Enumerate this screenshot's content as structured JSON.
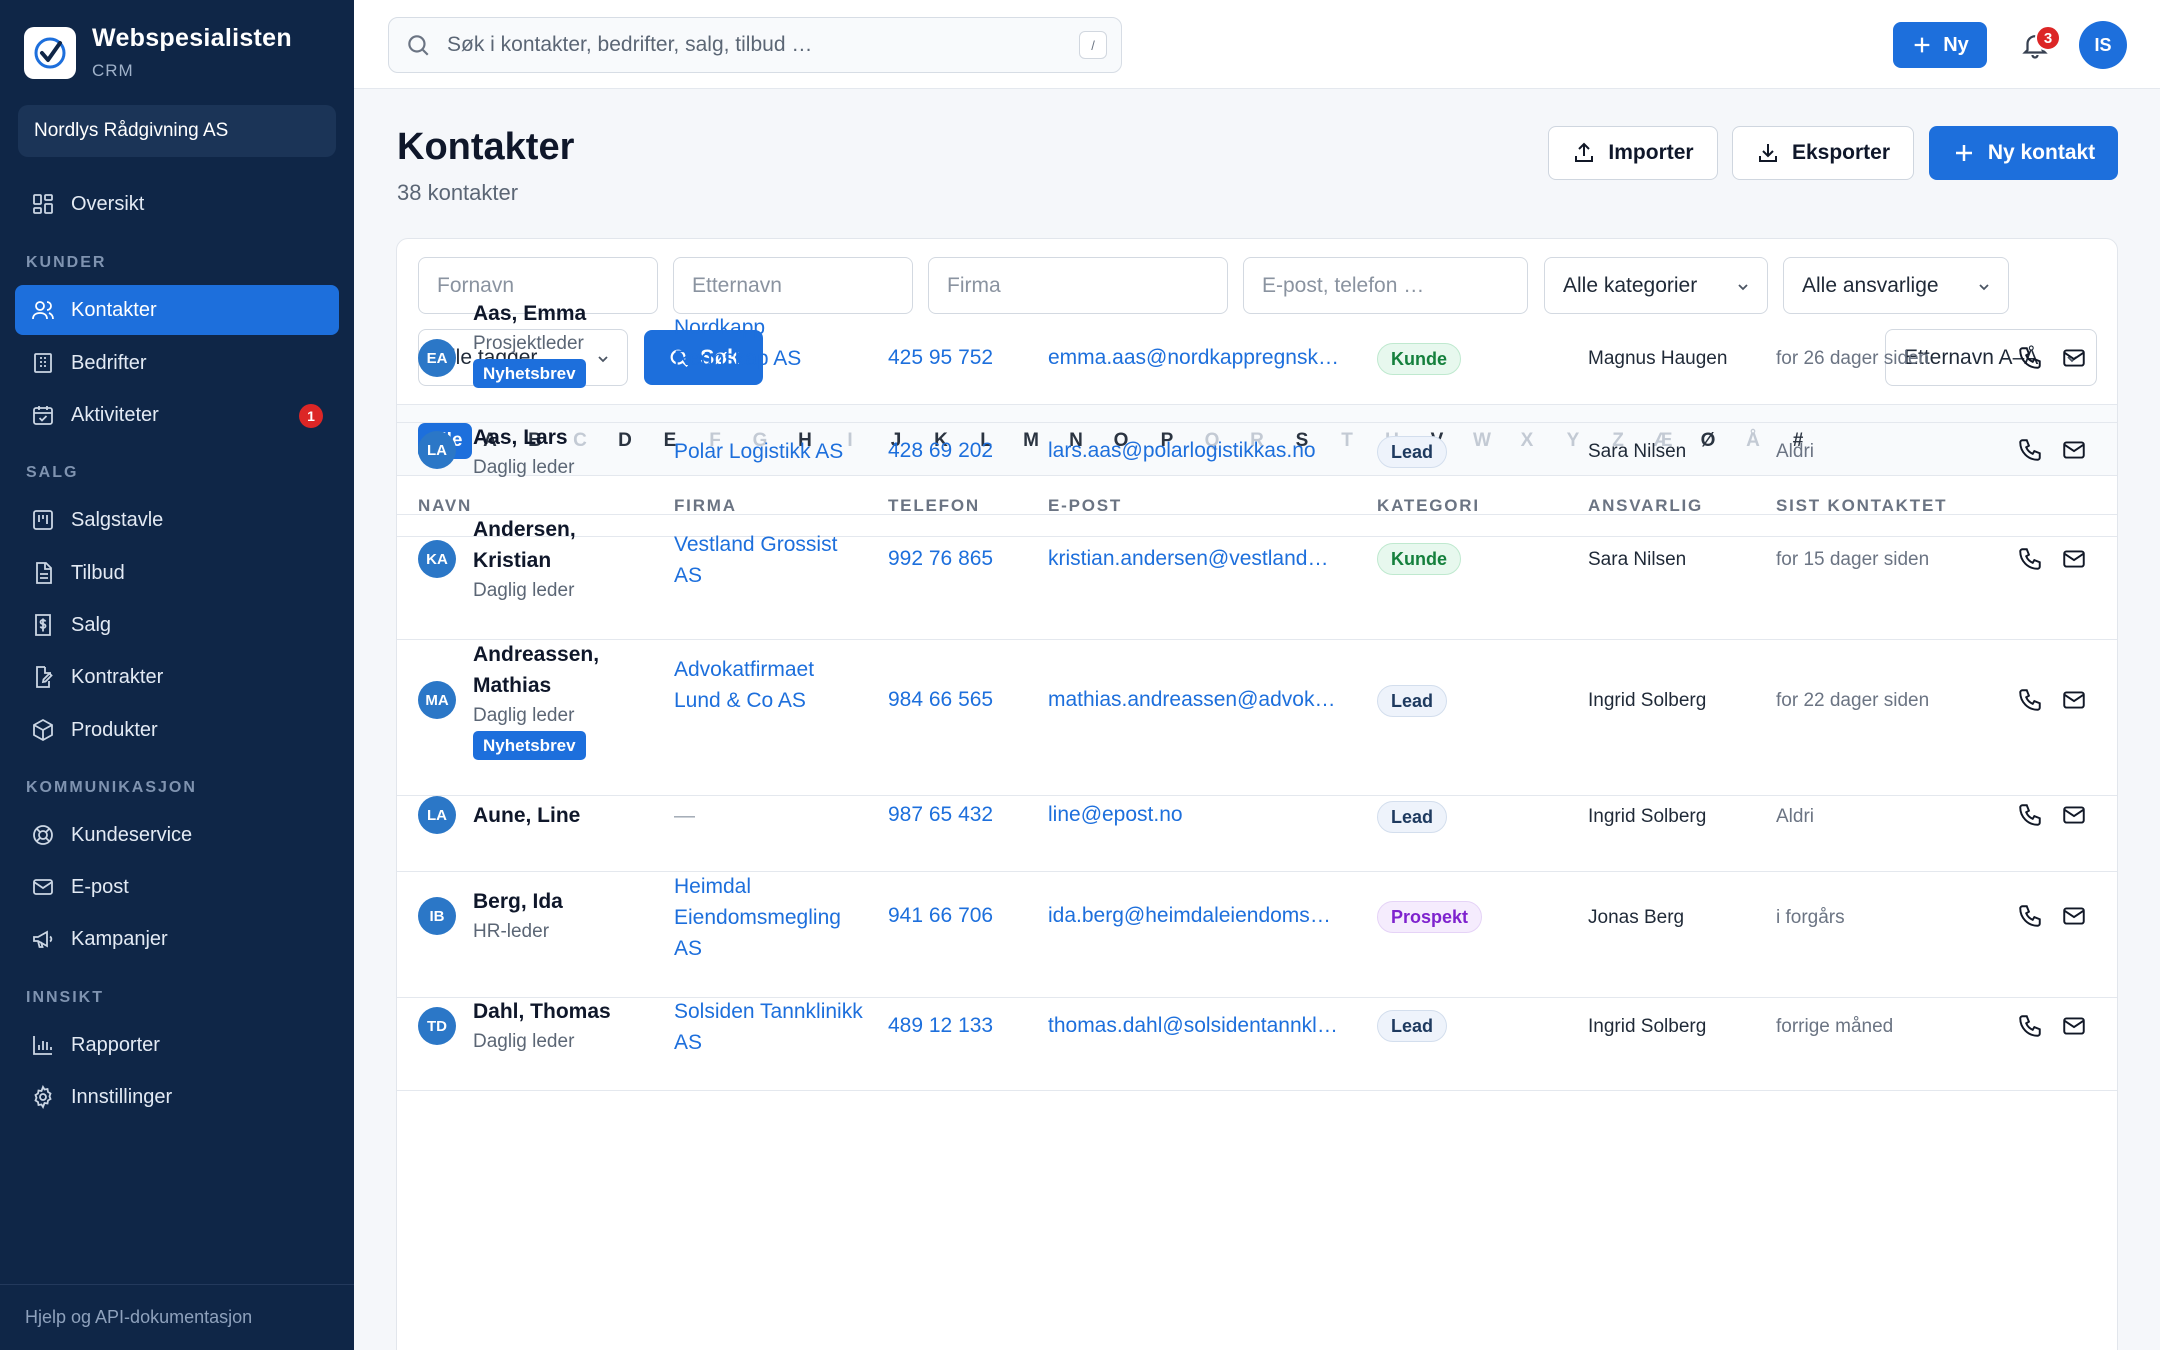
{
  "brand": {
    "name": "Webspesialisten",
    "sub": "CRM"
  },
  "org": "Nordlys Rådgivning AS",
  "nav": {
    "overview": "Oversikt",
    "section_kunder": "KUNDER",
    "contacts": "Kontakter",
    "companies": "Bedrifter",
    "activities": "Aktiviteter",
    "activities_badge": "1",
    "section_salg": "SALG",
    "pipeline": "Salgstavle",
    "offers": "Tilbud",
    "sales": "Salg",
    "contracts": "Kontrakter",
    "products": "Produkter",
    "section_komm": "KOMMUNIKASJON",
    "support": "Kundeservice",
    "email": "E-post",
    "campaigns": "Kampanjer",
    "section_innsikt": "INNSIKT",
    "reports": "Rapporter",
    "settings": "Innstillinger",
    "footer": "Hjelp og API-dokumentasjon"
  },
  "topbar": {
    "search_placeholder": "Søk i kontakter, bedrifter, salg, tilbud …",
    "shortcut": "/",
    "new_label": "Ny",
    "notif_count": "3",
    "user_initials": "IS"
  },
  "page": {
    "title": "Kontakter",
    "subtitle": "38 kontakter",
    "import_label": "Importer",
    "export_label": "Eksporter",
    "new_contact_label": "Ny kontakt"
  },
  "filters": {
    "first_name": "Fornavn",
    "last_name": "Etternavn",
    "company": "Firma",
    "contact_info": "E-post, telefon …",
    "category": "Alle kategorier",
    "owner": "Alle ansvarlige",
    "tags": "Alle tagger",
    "search_label": "Søk",
    "sort": "Etternavn A–Å"
  },
  "alphabet": {
    "all": "Alle",
    "letters": [
      {
        "l": "A",
        "on": true
      },
      {
        "l": "B",
        "on": true
      },
      {
        "l": "C",
        "on": false
      },
      {
        "l": "D",
        "on": true
      },
      {
        "l": "E",
        "on": true
      },
      {
        "l": "F",
        "on": false
      },
      {
        "l": "G",
        "on": false
      },
      {
        "l": "H",
        "on": true
      },
      {
        "l": "I",
        "on": false
      },
      {
        "l": "J",
        "on": true
      },
      {
        "l": "K",
        "on": true
      },
      {
        "l": "L",
        "on": true
      },
      {
        "l": "M",
        "on": true
      },
      {
        "l": "N",
        "on": true
      },
      {
        "l": "O",
        "on": true
      },
      {
        "l": "P",
        "on": true
      },
      {
        "l": "Q",
        "on": false
      },
      {
        "l": "R",
        "on": false
      },
      {
        "l": "S",
        "on": true
      },
      {
        "l": "T",
        "on": false
      },
      {
        "l": "U",
        "on": false
      },
      {
        "l": "V",
        "on": true
      },
      {
        "l": "W",
        "on": false
      },
      {
        "l": "X",
        "on": false
      },
      {
        "l": "Y",
        "on": false
      },
      {
        "l": "Z",
        "on": false
      },
      {
        "l": "Æ",
        "on": false
      },
      {
        "l": "Ø",
        "on": true
      },
      {
        "l": "Å",
        "on": false
      },
      {
        "l": "#",
        "on": true
      }
    ]
  },
  "columns": {
    "name": "NAVN",
    "company": "FIRMA",
    "phone": "TELEFON",
    "email": "E-POST",
    "category": "KATEGORI",
    "owner": "ANSVARLIG",
    "last": "SIST KONTAKTET"
  },
  "contacts": [
    {
      "initials": "EA",
      "name": "Aas, Emma",
      "role": "Prosjektleder",
      "tag": "Nyhetsbrev",
      "company": "Nordkapp Regnskap AS",
      "phone": "425 95 752",
      "email": "emma.aas@nordkappregnskapas.no",
      "category": "Kunde",
      "owner": "Magnus Haugen",
      "last": "for 26 dager siden"
    },
    {
      "initials": "LA",
      "name": "Aas, Lars",
      "role": "Daglig leder",
      "tag": "",
      "company": "Polar Logistikk AS",
      "phone": "428 69 202",
      "email": "lars.aas@polarlogistikkas.no",
      "category": "Lead",
      "owner": "Sara Nilsen",
      "last": "Aldri"
    },
    {
      "initials": "KA",
      "name": "Andersen, Kristian",
      "role": "Daglig leder",
      "tag": "",
      "company": "Vestland Grossist AS",
      "phone": "992 76 865",
      "email": "kristian.andersen@vestlandgrossistas.no",
      "category": "Kunde",
      "owner": "Sara Nilsen",
      "last": "for 15 dager siden"
    },
    {
      "initials": "MA",
      "name": "Andreassen, Mathias",
      "role": "Daglig leder",
      "tag": "Nyhetsbrev",
      "company": "Advokatfirmaet Lund & Co AS",
      "phone": "984 66 565",
      "email": "mathias.andreassen@advokatfirmaet.no",
      "category": "Lead",
      "owner": "Ingrid Solberg",
      "last": "for 22 dager siden"
    },
    {
      "initials": "LA",
      "name": "Aune, Line",
      "role": "",
      "tag": "",
      "company": "—",
      "phone": "987 65 432",
      "email": "line@epost.no",
      "category": "Lead",
      "owner": "Ingrid Solberg",
      "last": "Aldri"
    },
    {
      "initials": "IB",
      "name": "Berg, Ida",
      "role": "HR-leder",
      "tag": "",
      "company": "Heimdal Eiendomsmegling AS",
      "phone": "941 66 706",
      "email": "ida.berg@heimdaleiendomsmegling.no",
      "category": "Prospekt",
      "owner": "Jonas Berg",
      "last": "i forgårs"
    },
    {
      "initials": "TD",
      "name": "Dahl, Thomas",
      "role": "Daglig leder",
      "tag": "",
      "company": "Solsiden Tannklinikk AS",
      "phone": "489 12 133",
      "email": "thomas.dahl@solsidentannklinikk.no",
      "category": "Lead",
      "owner": "Ingrid Solberg",
      "last": "forrige måned"
    }
  ],
  "colors": {
    "sidebar": "#0f2647",
    "primary": "#1d6fdc",
    "danger": "#dc2626"
  }
}
